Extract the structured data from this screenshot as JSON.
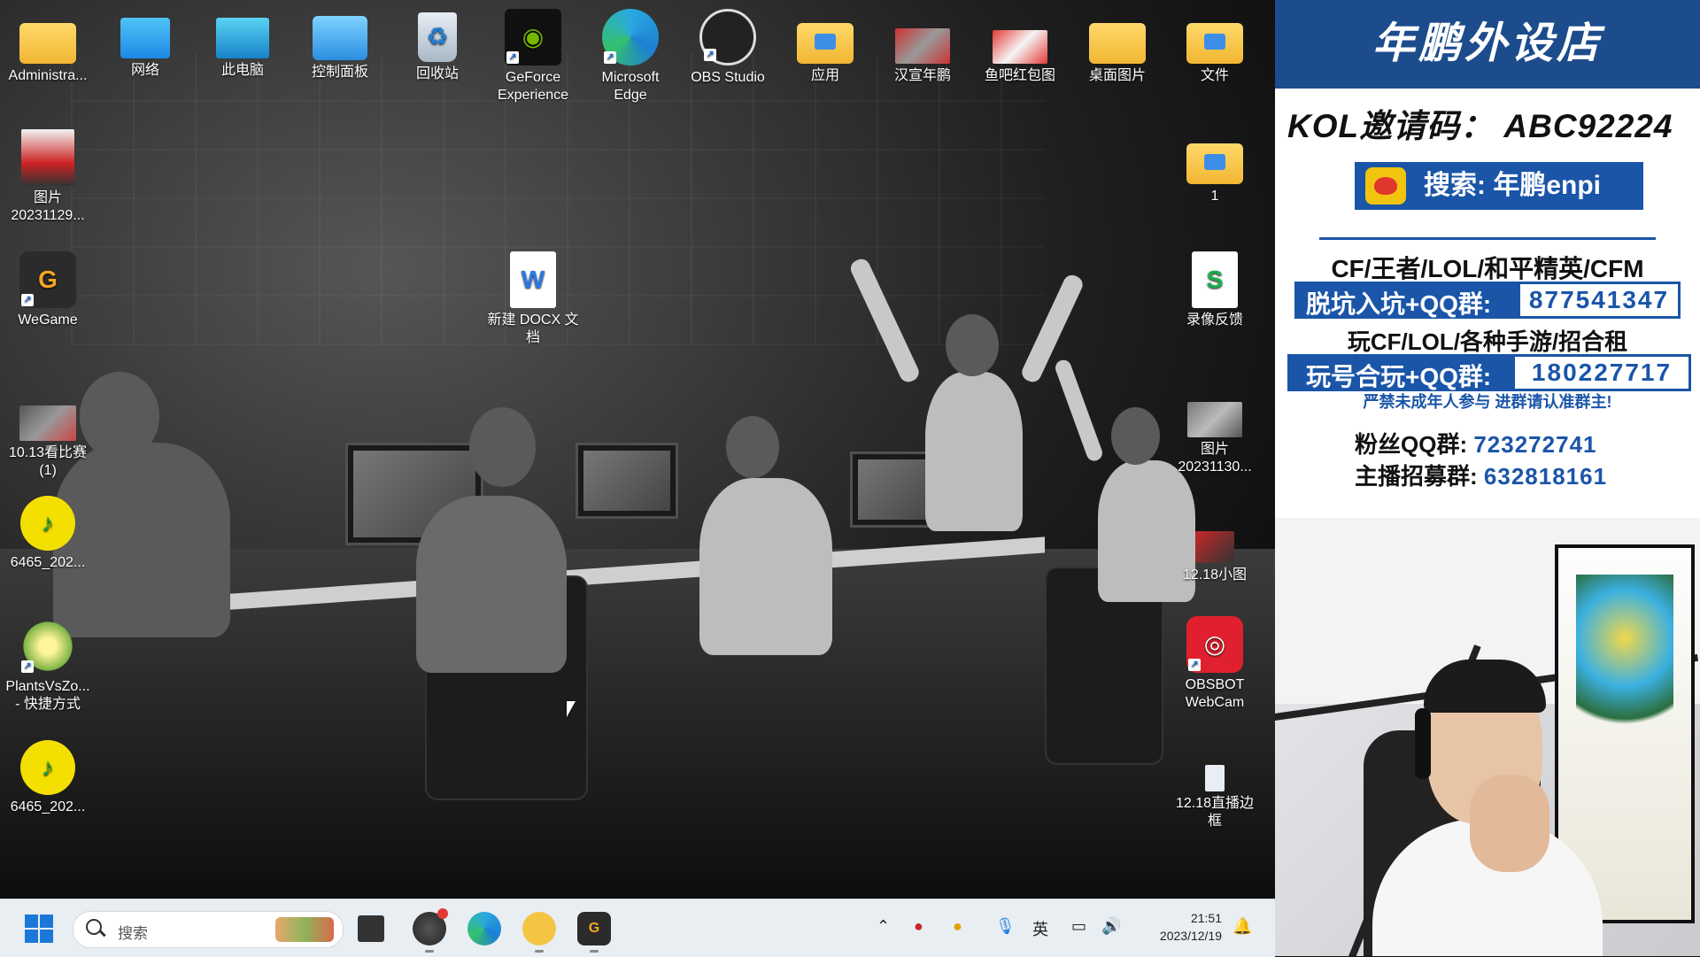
{
  "desktop": {
    "icons": [
      {
        "id": "admin",
        "label": "Administra...",
        "icon": "folder-icon"
      },
      {
        "id": "network",
        "label": "网络",
        "icon": "network-icon"
      },
      {
        "id": "pc",
        "label": "此电脑",
        "icon": "computer-icon"
      },
      {
        "id": "control",
        "label": "控制面板",
        "icon": "control-panel-icon"
      },
      {
        "id": "recycle",
        "label": "回收站",
        "icon": "recycle-bin-icon"
      },
      {
        "id": "geforce",
        "label": "GeForce Experience",
        "icon": "geforce-icon"
      },
      {
        "id": "edge",
        "label": "Microsoft Edge",
        "icon": "edge-icon"
      },
      {
        "id": "obs",
        "label": "OBS Studio",
        "icon": "obs-icon"
      },
      {
        "id": "apps",
        "label": "应用",
        "icon": "folder-icon"
      },
      {
        "id": "hanxuan",
        "label": "汉宣年鹏",
        "icon": "image-icon"
      },
      {
        "id": "yuba",
        "label": "鱼吧红包图",
        "icon": "image-icon"
      },
      {
        "id": "desk-pics",
        "label": "桌面图片",
        "icon": "folder-icon"
      },
      {
        "id": "files",
        "label": "文件",
        "icon": "folder-icon"
      },
      {
        "id": "pic1129",
        "label": "图片 20231129...",
        "icon": "image-icon"
      },
      {
        "id": "folder1",
        "label": "1",
        "icon": "folder-icon"
      },
      {
        "id": "wegame",
        "label": "WeGame",
        "icon": "wegame-icon"
      },
      {
        "id": "docx",
        "label": "新建 DOCX 文档",
        "icon": "word-doc-icon"
      },
      {
        "id": "record",
        "label": "录像反馈",
        "icon": "sheet-icon"
      },
      {
        "id": "match",
        "label": "10.13看比赛 (1)",
        "icon": "image-icon"
      },
      {
        "id": "pic1130",
        "label": "图片 20231130...",
        "icon": "image-icon"
      },
      {
        "id": "music1",
        "label": "6465_202...",
        "icon": "music-icon"
      },
      {
        "id": "pic1218",
        "label": "12.18小图",
        "icon": "image-icon"
      },
      {
        "id": "pvz",
        "label": "PlantsVsZo... - 快捷方式",
        "icon": "game-icon"
      },
      {
        "id": "obsbot",
        "label": "OBSBOT WebCam",
        "icon": "webcam-icon"
      },
      {
        "id": "music2",
        "label": "6465_202...",
        "icon": "music-icon"
      },
      {
        "id": "frame",
        "label": "12.18直播边框",
        "icon": "file-icon"
      }
    ]
  },
  "taskbar": {
    "search_placeholder": "搜索",
    "apps": [
      "file-manager-icon",
      "obs-icon",
      "edge-icon",
      "game-helper-icon",
      "wegame-icon"
    ],
    "tray": {
      "ime": "英"
    },
    "time": "21:51",
    "date": "2023/12/19"
  },
  "panel": {
    "title": "年鹏外设店",
    "kol": "KOL邀请码： ABC92224",
    "weibo": "搜索: 年鹏enpi",
    "games1": "CF/王者/LOL/和平精英/CFM",
    "group1_label": "脱坑入坑+QQ群:",
    "group1_num": "877541347",
    "games2": "玩CF/LOL/各种手游/招合租",
    "group2_label": "玩号合玩+QQ群:",
    "group2_num": "180227717",
    "warning": "严禁未成年人参与  进群请认准群主!",
    "fans_label": "粉丝QQ群:",
    "fans_num": "723272741",
    "anchor_label": "主播招募群:",
    "anchor_num": "632818161",
    "colors": {
      "brand": "#1c4c8c",
      "accent": "#1a55a8"
    }
  }
}
